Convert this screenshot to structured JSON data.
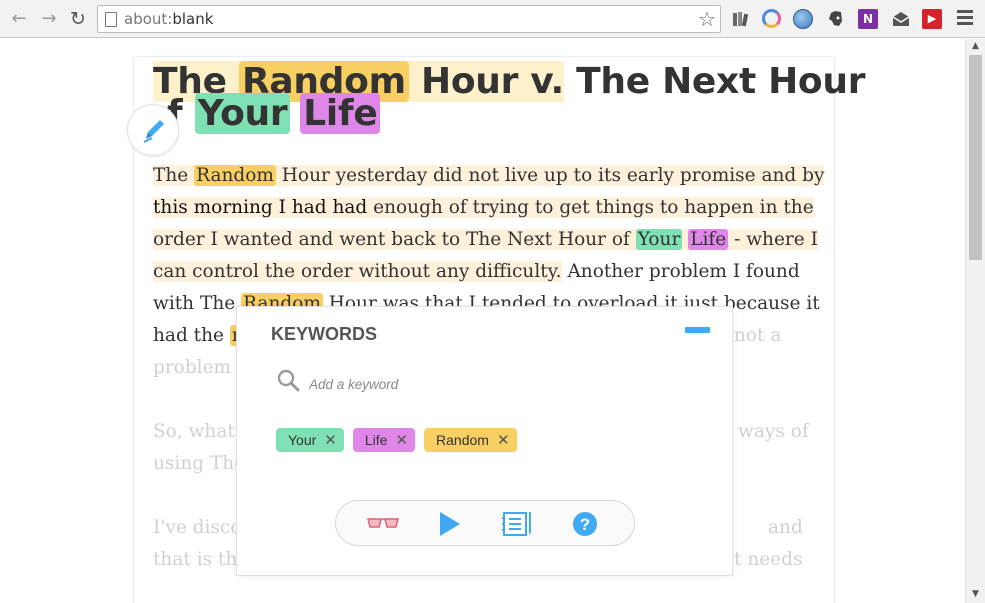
{
  "browser": {
    "url_prefix": "about:",
    "url_rest": "blank",
    "back_glyph": "←",
    "forward_glyph": "→",
    "reload_glyph": "↻",
    "star_glyph": "☆",
    "extensions": [
      "books-icon",
      "circle-icon",
      "globe-icon",
      "evernote-icon",
      "onenote-icon",
      "mail-icon",
      "video-icon"
    ],
    "onenote_label": "N",
    "video_label": "▶"
  },
  "article": {
    "title_parts": {
      "the": "The ",
      "random": "Random",
      "hour_v": " Hour v.",
      "rest_line1": " The Next Hour",
      "of_f": "f ",
      "your": "Your",
      "life": "Life"
    },
    "lines": [
      [
        "The ",
        "Random",
        " Hour yesterday did not live up to its early promise and by"
      ],
      [
        "this morning I had had",
        " enough of trying to get things to happen in the"
      ],
      [
        "order I wanted and went back to The Next Hour of ",
        "Your",
        " ",
        "Life",
        " - where I"
      ],
      [
        "can control the order without any difficulty.",
        " Another problem I found"
      ],
      [
        "with The ",
        "Random",
        " Hour was that I tended to overload it just because it"
      ],
      [
        "had the ",
        "r",
        "",
        "not a"
      ],
      [
        "problem"
      ],
      [
        ""
      ],
      [
        "So, what",
        "ways of"
      ],
      [
        "using The"
      ],
      [
        ""
      ],
      [
        "I've disco",
        "and"
      ],
      [
        "that is th",
        "t needs"
      ]
    ]
  },
  "keywords_panel": {
    "title": "KEYWORDS",
    "search_placeholder": "Add a keyword",
    "tags": [
      {
        "label": "Your",
        "color": "#7ee0b3"
      },
      {
        "label": "Life",
        "color": "#de87e8"
      },
      {
        "label": "Random",
        "color": "#f8cf62"
      }
    ],
    "tag_close_glyph": "✕",
    "bottom_icons": [
      "glasses-icon",
      "play-icon",
      "notes-icon",
      "help-icon"
    ]
  },
  "colors": {
    "accent_blue": "#3fa9f5",
    "kw_yellow": "#f8cf62",
    "kw_green": "#7ee0b3",
    "kw_purple": "#de87e8"
  }
}
